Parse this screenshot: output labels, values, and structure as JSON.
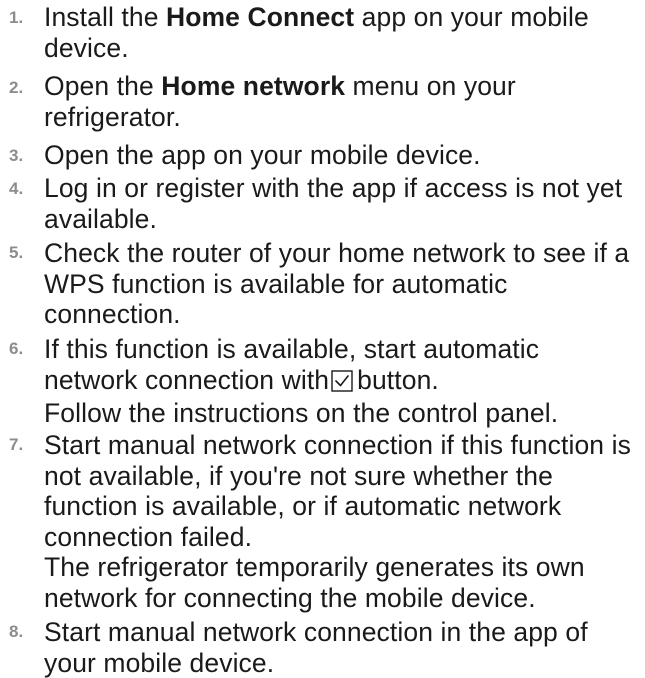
{
  "steps": [
    {
      "number": "1.",
      "lines": [
        {
          "pre": "Install the ",
          "bold": "Home Connect",
          "post": " app on your mobile"
        },
        {
          "text": "device."
        }
      ]
    },
    {
      "number": "2.",
      "lines": [
        {
          "pre": "Open the ",
          "bold": "Home network",
          "post": " menu on your"
        },
        {
          "text": "refrigerator."
        }
      ]
    },
    {
      "number": "3.",
      "lines": [
        {
          "text": "Open the app on your mobile device."
        }
      ]
    },
    {
      "number": "4.",
      "lines": [
        {
          "text": "Log in or register with the app if access is not yet"
        },
        {
          "text": "available."
        }
      ]
    },
    {
      "number": "5.",
      "lines": [
        {
          "text": "Check the router of your home network to see if a"
        },
        {
          "text": "WPS function is available for automatic"
        },
        {
          "text": "connection."
        }
      ]
    },
    {
      "number": "6.",
      "lines": [
        {
          "text": "If this function is available, start automatic"
        },
        {
          "pre": "network connection with",
          "icon": "check-box-icon",
          "post": "button."
        },
        {
          "text": "Follow the instructions on the control panel."
        }
      ]
    },
    {
      "number": "7.",
      "lines": [
        {
          "text": "Start manual network connection if this function is"
        },
        {
          "text": "not available, if you're not sure whether the"
        },
        {
          "text": "function is available, or if automatic network"
        },
        {
          "text": "connection failed."
        },
        {
          "text": "The refrigerator temporarily generates its own"
        },
        {
          "text": "network for connecting the mobile device."
        }
      ]
    },
    {
      "number": "8.",
      "lines": [
        {
          "text": "Start manual network connection in the app of"
        },
        {
          "text": "your mobile device."
        }
      ]
    }
  ]
}
